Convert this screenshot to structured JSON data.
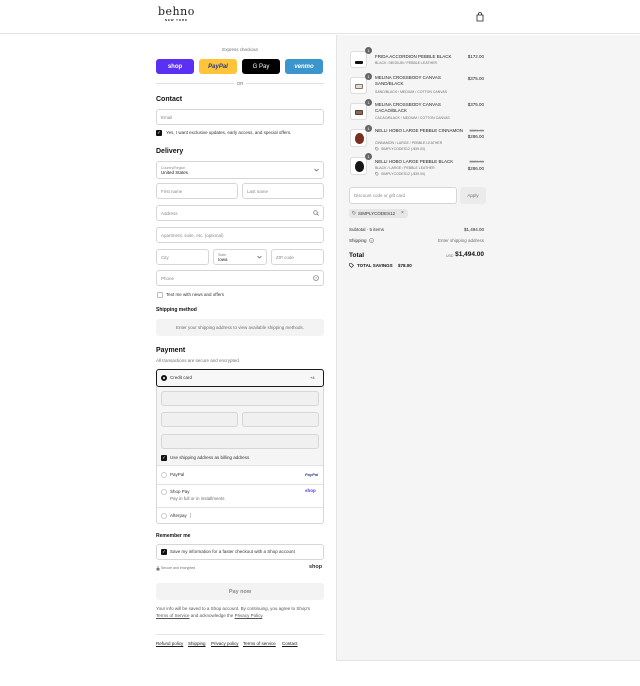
{
  "brand": {
    "name": "behno",
    "sub": "NEW YORK"
  },
  "express": {
    "title": "Express checkout",
    "or": "OR",
    "buttons": [
      {
        "label": "shop",
        "color": "#5a31f4",
        "text_color": "#ffffff"
      },
      {
        "label": "PayPal",
        "color": "#ffc439",
        "text_color": "#253b80"
      },
      {
        "label": "G Pay",
        "color": "#000000",
        "text_color": "#ffffff"
      },
      {
        "label": "venmo",
        "color": "#3d95ce",
        "text_color": "#ffffff"
      }
    ]
  },
  "contact": {
    "title": "Contact",
    "email_placeholder": "Email",
    "updates_label": "Yes, I want exclusive updates, early access, and special offers."
  },
  "delivery": {
    "title": "Delivery",
    "country_label": "Country/Region",
    "country_value": "United States",
    "first_name": "First name",
    "last_name": "Last name",
    "address": "Address",
    "apartment": "Apartment, suite, etc. (optional)",
    "city": "City",
    "state_label": "State",
    "state_value": "Iowa",
    "zip": "ZIP code",
    "phone": "Phone",
    "sms_label": "Text me with news and offers"
  },
  "shipping": {
    "title": "Shipping method",
    "placeholder": "Enter your shipping address to view available shipping methods."
  },
  "payment": {
    "title": "Payment",
    "subtitle": "All transactions are secure and encrypted.",
    "credit_card": "Credit card",
    "card_more": "+4",
    "billing_same": "Use shipping address as billing address",
    "paypal": "PayPal",
    "paypal_logo": "PayPal",
    "shop_pay": "Shop Pay",
    "shop_pay_sub": "Pay in full or in installments",
    "shop_pay_logo": "shop",
    "afterpay": "Afterpay"
  },
  "remember": {
    "title": "Remember me",
    "save_label": "Save my information for a faster checkout with a Shop account",
    "secure": "Secure and encrypted",
    "shop_logo": "shop"
  },
  "pay_now": "Pay now",
  "legal": {
    "line1": "Your info will be saved to a Shop account. By continuing, you agree to Shop's",
    "terms": "Terms of Service",
    "and": " and acknowledge the ",
    "privacy": "Privacy Policy",
    "end": "."
  },
  "footer": [
    "Refund policy",
    "Shipping",
    "Privacy policy",
    "Terms of service",
    "Contact"
  ],
  "cart": {
    "items": [
      {
        "qty": "1",
        "name": "FRIDA ACCORDION PEBBLE BLACK",
        "variant": "BLACK / MEDIUM / PEBBLE LEATHER",
        "price": "$172.00",
        "compare": "",
        "discount": ""
      },
      {
        "qty": "1",
        "name": "MELINA CROSSBODY CANVAS SAND/BLACK",
        "variant": "SAND/BLACK / MEDIUM / COTTON CANVAS",
        "price": "$375.00",
        "compare": "",
        "discount": ""
      },
      {
        "qty": "1",
        "name": "MELINA CROSSBODY CANVAS CACAO/BLACK",
        "variant": "CACAO/BLACK / MEDIUM / COTTON CANVAS",
        "price": "$375.00",
        "compare": "",
        "discount": ""
      },
      {
        "qty": "1",
        "name": "NELLI HOBO LARGE PEBBLE CINNAMON",
        "variant": "CINNAMON / LARGE / PEBBLE LEATHER",
        "price": "$286.00",
        "compare": "$325.00",
        "discount": "SIMPLYCODES12 (-$39.00)"
      },
      {
        "qty": "1",
        "name": "NELLI HOBO LARGE PEBBLE BLACK",
        "variant": "BLACK / LARGE / PEBBLE LEATHER",
        "price": "$286.00",
        "compare": "$325.00",
        "discount": "SIMPLYCODES12 (-$39.00)"
      }
    ],
    "discount_placeholder": "Discount code or gift card",
    "apply": "Apply",
    "applied_code": "SIMPLYCODES12",
    "subtotal_label": "Subtotal · 5 items",
    "subtotal_value": "$1,494.00",
    "shipping_label": "Shipping",
    "shipping_value": "Enter shipping address",
    "total_label": "Total",
    "currency": "USD",
    "total_value": "$1,494.00",
    "savings_label": "TOTAL SAVINGS",
    "savings_value": "$78.00"
  }
}
